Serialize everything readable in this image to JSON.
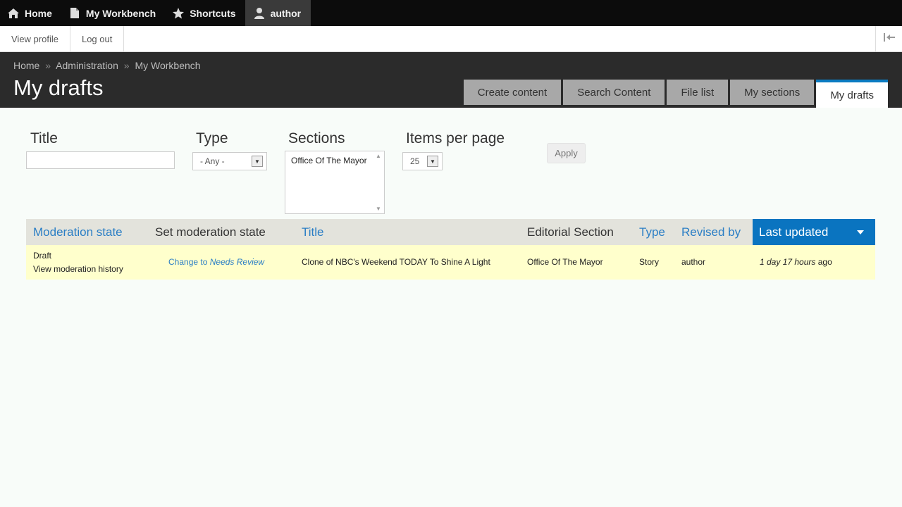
{
  "toolbar": {
    "home": "Home",
    "workbench": "My Workbench",
    "shortcuts": "Shortcuts",
    "user": "author"
  },
  "subbar": {
    "view_profile": "View profile",
    "log_out": "Log out"
  },
  "breadcrumb": {
    "home": "Home",
    "separator": "»",
    "administration": "Administration",
    "workbench": "My Workbench"
  },
  "page_title": "My drafts",
  "tabs": [
    {
      "label": "Create content"
    },
    {
      "label": "Search Content"
    },
    {
      "label": "File list"
    },
    {
      "label": "My sections"
    },
    {
      "label": "My drafts",
      "active": true
    }
  ],
  "filters": {
    "title_label": "Title",
    "title_value": "",
    "type_label": "Type",
    "type_value": "- Any -",
    "sections_label": "Sections",
    "sections_options": [
      "Office Of The Mayor"
    ],
    "items_label": "Items per page",
    "items_value": "25",
    "apply_label": "Apply"
  },
  "table": {
    "columns": [
      {
        "label": "Moderation state",
        "sortable": true
      },
      {
        "label": "Set moderation state",
        "sortable": false
      },
      {
        "label": "Title",
        "sortable": true
      },
      {
        "label": "Editorial Section",
        "sortable": false
      },
      {
        "label": "Type",
        "sortable": true
      },
      {
        "label": "Revised by",
        "sortable": true
      },
      {
        "label": "Last updated",
        "sortable": true,
        "sorted": "desc"
      }
    ],
    "rows": [
      {
        "state": "Draft",
        "history_link": "View moderation history",
        "change_prefix": "Change to",
        "change_target": "Needs Review",
        "title": "Clone of NBC's Weekend TODAY To Shine A Light",
        "section": "Office Of The Mayor",
        "type": "Story",
        "revised_by": "author",
        "updated_italic": "1 day 17 hours",
        "updated_suffix": "ago"
      }
    ]
  },
  "colors": {
    "toolbar_bg": "#0c0c0c",
    "header_bg": "#2b2b2b",
    "accent": "#0a74c0",
    "link": "#2a7ec5",
    "row_highlight": "#ffffcc"
  }
}
